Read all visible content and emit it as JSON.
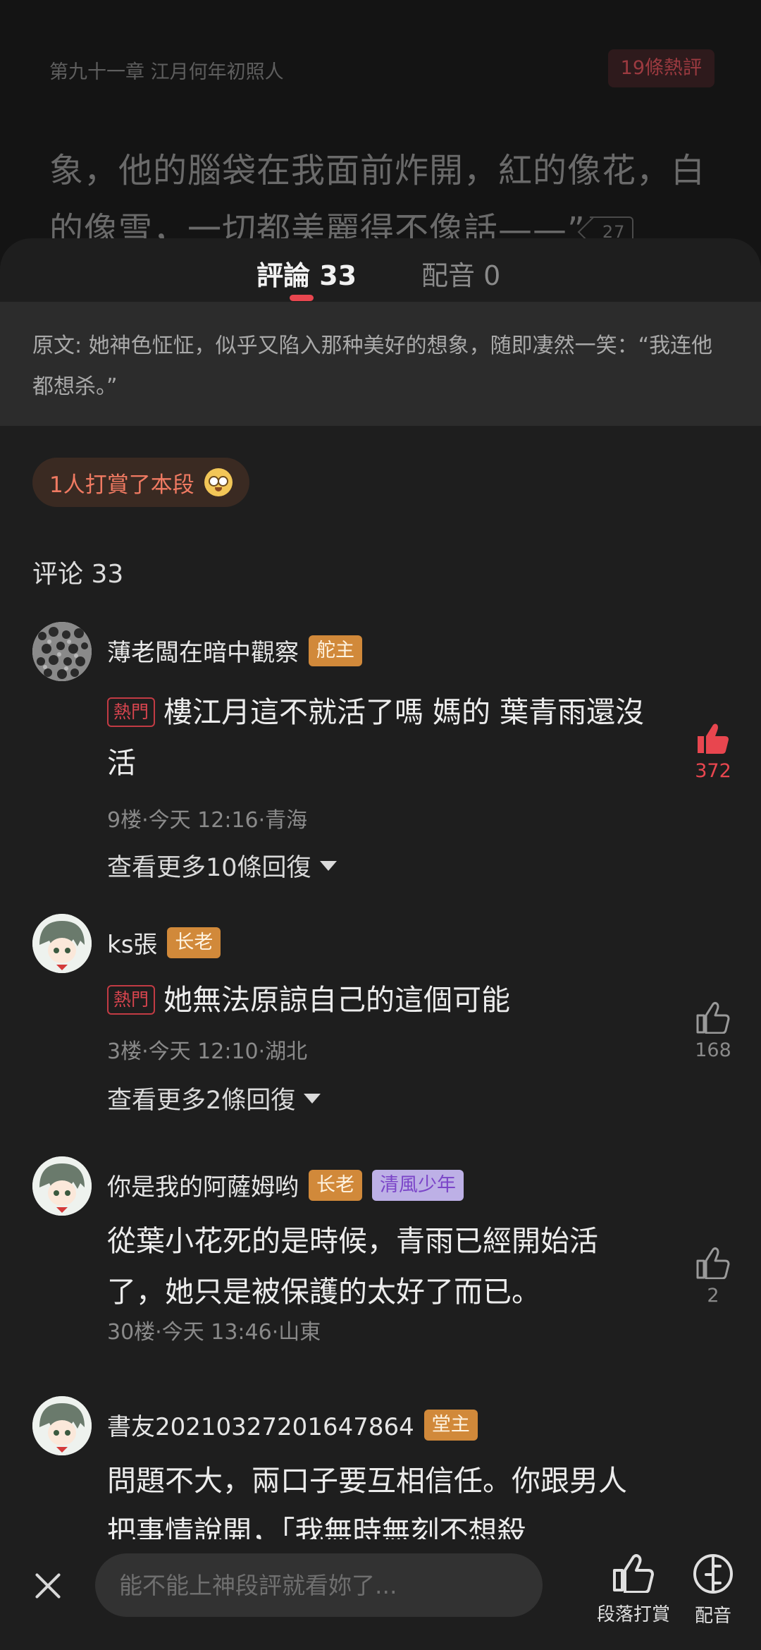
{
  "reader": {
    "chapter_title": "第九十一章 江月何年初照人",
    "hot_badge": "19條熱評",
    "text_line1": "象，他的腦袋在我面前炸開，紅的像花，白",
    "text_line2": "的像雪，一切都美麗得不像話——”",
    "paragraph_comment_count": "27"
  },
  "tabs": [
    {
      "label": "評論 33",
      "active": true
    },
    {
      "label": "配音 0",
      "active": false
    }
  ],
  "original_text": "原文: 她神色怔怔，似乎又陷入那种美好的想象，随即凄然一笑：“我连他都想杀。”",
  "reward_summary": "1人打賞了本段",
  "section_title": "评论 33",
  "hot_tag_label": "熱門",
  "comments": [
    {
      "username": "薄老闆在暗中觀察",
      "tags": [
        "舵主"
      ],
      "hot": true,
      "text": "樓江月這不就活了嗎 媽的 葉青雨還沒活",
      "meta": "9楼·今天 12:16·青海",
      "more_replies": "查看更多10條回復",
      "likes": "372",
      "liked": true
    },
    {
      "username": "ks張",
      "tags": [
        "长老"
      ],
      "hot": true,
      "text": "她無法原諒自己的這個可能",
      "meta": "3楼·今天 12:10·湖北",
      "more_replies": "查看更多2條回復",
      "likes": "168",
      "liked": false
    },
    {
      "username": "你是我的阿薩姆哟",
      "tags": [
        "长老",
        "清風少年"
      ],
      "hot": false,
      "text": "從葉小花死的是時候，青雨已經開始活了，她只是被保護的太好了而已。",
      "meta": "30楼·今天 13:46·山東",
      "likes": "2",
      "liked": false
    },
    {
      "username": "書友20210327201647864",
      "tags": [
        "堂主"
      ],
      "hot": false,
      "text": "問題不大，兩口子要互相信任。你跟男人把事情說開，「我無時無刻不想殺"
    }
  ],
  "bottom_bar": {
    "input_placeholder": "能不能上神段評就看妳了...",
    "reward_label": "段落打賞",
    "dub_label": "配音"
  },
  "colors": {
    "accent": "#e8464f",
    "tag_gold": "#d1893a",
    "tag_purple_bg": "#bdb0e6",
    "background": "#1e1e1e"
  }
}
